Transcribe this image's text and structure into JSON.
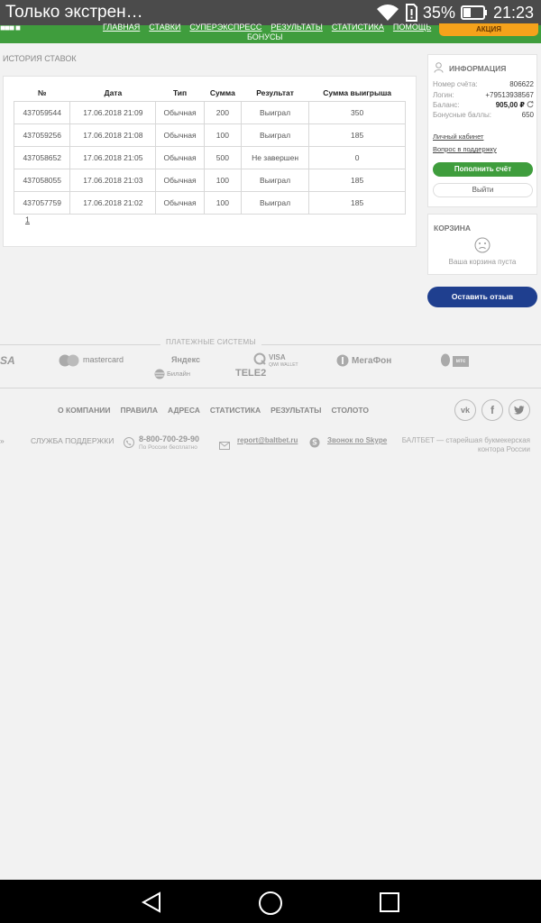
{
  "statusbar": {
    "notification": "Только экстрен…",
    "battery": "35%",
    "time": "21:23",
    "icons": [
      "wifi-icon",
      "sim-alert-icon",
      "battery-icon"
    ]
  },
  "nav": {
    "links": [
      "ГЛАВНАЯ",
      "СТАВКИ",
      "СУПЕРЭКСПРЕСС",
      "РЕЗУЛЬТАТЫ",
      "СТАТИСТИКА",
      "ПОМОЩЬ"
    ],
    "bonus": "БОНУСЫ",
    "promo": "АКЦИЯ"
  },
  "history": {
    "label": "ИСТОРИЯ СТАВОК",
    "columns": [
      "№",
      "Дата",
      "Тип",
      "Сумма",
      "Результат",
      "Сумма выигрыша"
    ],
    "rows": [
      [
        "437059544",
        "17.06.2018 21:09",
        "Обычная",
        "200",
        "Выиграл",
        "350"
      ],
      [
        "437059256",
        "17.06.2018 21:08",
        "Обычная",
        "100",
        "Выиграл",
        "185"
      ],
      [
        "437058652",
        "17.06.2018 21:05",
        "Обычная",
        "500",
        "Не завершен",
        "0"
      ],
      [
        "437058055",
        "17.06.2018 21:03",
        "Обычная",
        "100",
        "Выиграл",
        "185"
      ],
      [
        "437057759",
        "17.06.2018 21:02",
        "Обычная",
        "100",
        "Выиграл",
        "185"
      ]
    ],
    "page": "1"
  },
  "info": {
    "title": "ИНФОРМАЦИЯ",
    "account_label": "Номер счёта:",
    "account": "806622",
    "login_label": "Логин:",
    "login": "+79513938567",
    "balance_label": "Баланс:",
    "balance": "905,00 ₽",
    "bonus_label": "Бонусные баллы:",
    "bonus": "650",
    "cabinet_link": "Личный кабинет",
    "support_link": "Вопрос в поддержку",
    "topup_button": "Пополнить счёт",
    "exit_button": "Выйти"
  },
  "cart": {
    "title": "КОРЗИНА",
    "empty": "Ваша корзина пуста"
  },
  "review_button": "Оставить отзыв",
  "payments": {
    "label": "ПЛАТЕЖНЫЕ СИСТЕМЫ",
    "logos": [
      "SA",
      "mastercard",
      "Яндекс",
      "VISA",
      "QIWI WALLET",
      "МегаФон",
      "мтс",
      "Билайн",
      "TELE2"
    ]
  },
  "footer": {
    "links": [
      "О КОМПАНИИ",
      "ПРАВИЛА",
      "АДРЕСА",
      "СТАТИСТИКА",
      "РЕЗУЛЬТАТЫ",
      "СТОЛОТО"
    ],
    "support_label": "СЛУЖБА ПОДДЕРЖКИ",
    "phone": "8-800-700-29-90",
    "phone_sub": "По России бесплатно",
    "email": "report@baltbet.ru",
    "skype": "Звонок по Skype",
    "about": "БАЛТБЕТ — старейшая букмекерская контора России"
  }
}
